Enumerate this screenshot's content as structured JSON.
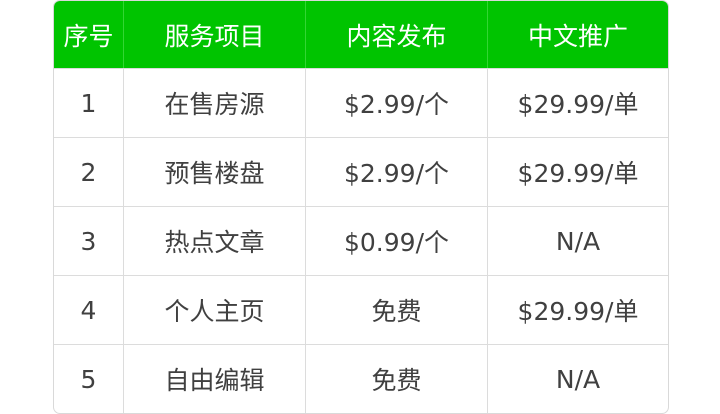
{
  "table": {
    "headers": [
      "序号",
      "服务项目",
      "内容发布",
      "中文推广"
    ],
    "rows": [
      [
        "1",
        "在售房源",
        "$2.99/个",
        "$29.99/单"
      ],
      [
        "2",
        "预售楼盘",
        "$2.99/个",
        "$29.99/单"
      ],
      [
        "3",
        "热点文章",
        "$0.99/个",
        "N/A"
      ],
      [
        "4",
        "个人主页",
        "免费",
        "$29.99/单"
      ],
      [
        "5",
        "自由编辑",
        "免费",
        "N/A"
      ]
    ]
  },
  "colors": {
    "header_bg": "#00c400",
    "header_text": "#ffffff",
    "body_text": "#404040",
    "grid_line": "#dcdcdc"
  }
}
